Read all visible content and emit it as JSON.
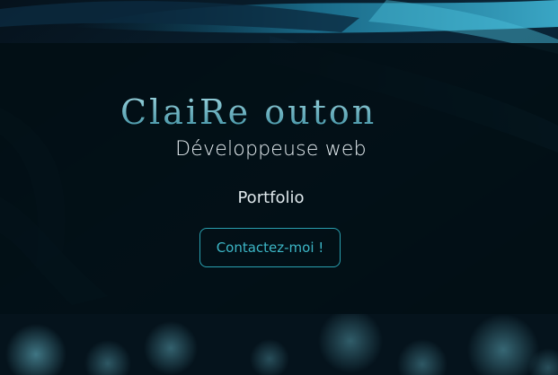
{
  "hero": {
    "logo_text": "ClaiRe   outon",
    "subtitle": "Développeuse web",
    "nav_link": "Portfolio",
    "cta_label": "Contactez-moi !"
  },
  "colors": {
    "accent": "#2aa0b0",
    "panel": "#020e14",
    "text": "#e6eef2"
  }
}
